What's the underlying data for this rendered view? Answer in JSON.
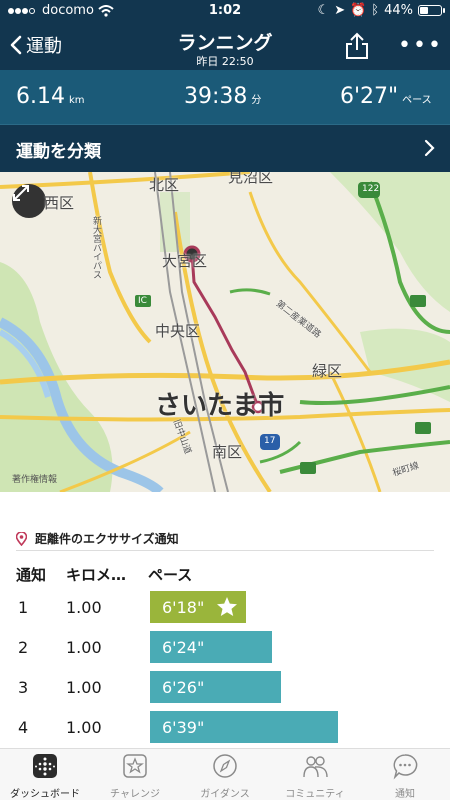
{
  "status": {
    "carrier": "docomo",
    "time": "1:02",
    "battery": "44%",
    "battery_level": 0.44
  },
  "nav": {
    "back_label": "運動",
    "title": "ランニング",
    "subtitle": "昨日 22:50"
  },
  "stats": {
    "distance": "6.14",
    "distance_unit": "km",
    "time": "39:38",
    "time_unit": "分",
    "pace": "6'27\"",
    "pace_unit": "ペース"
  },
  "classify": {
    "label": "運動を分類"
  },
  "map": {
    "labels": {
      "kita": "北区",
      "nishi": "西区",
      "minuma": "見沼区",
      "omiya": "大宮区",
      "chuo": "中央区",
      "midori": "緑区",
      "saitama": "さいたま市",
      "minami": "南区",
      "shin_omiya_bypass": "新大宮バイパス",
      "daiichi": "第二産業道路",
      "kyu_nakasendo": "旧中山道",
      "sakuracho": "桜町線",
      "route_122": "122",
      "route_17": "17",
      "ic": "IC"
    },
    "legal": "著作権情報"
  },
  "splits": {
    "title": "距離件のエクササイズ通知",
    "headers": {
      "split": "通知",
      "km": "キロメ…",
      "pace": "ペース"
    },
    "rows": [
      {
        "split": "1",
        "km": "1.00",
        "pace": "6'18\"",
        "pace_seconds": 378,
        "best": true
      },
      {
        "split": "2",
        "km": "1.00",
        "pace": "6'24\"",
        "pace_seconds": 384,
        "best": false
      },
      {
        "split": "3",
        "km": "1.00",
        "pace": "6'26\"",
        "pace_seconds": 386,
        "best": false
      },
      {
        "split": "4",
        "km": "1.00",
        "pace": "6'39\"",
        "pace_seconds": 399,
        "best": false
      }
    ]
  },
  "tabs": {
    "dashboard": "ダッシュボード",
    "challenge": "チャレンジ",
    "guidance": "ガイダンス",
    "community": "コミュニティ",
    "notifications": "通知"
  },
  "colors": {
    "header": "#12364f",
    "stats": "#1b5a78",
    "best_bar": "#9ab53b",
    "bar": "#4aabb5"
  }
}
